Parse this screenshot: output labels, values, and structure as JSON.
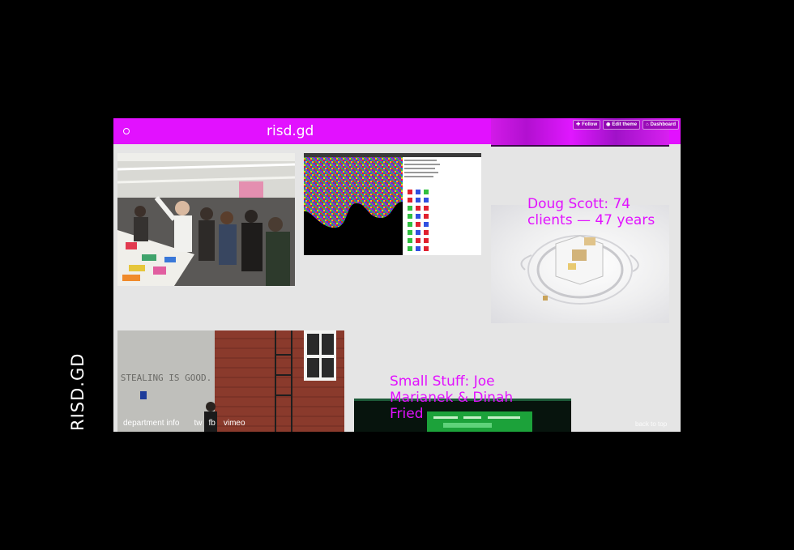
{
  "vertical_brand": "RISD.GD",
  "header": {
    "title": "risd.gd"
  },
  "tumblr_controls": {
    "follow": "Follow",
    "edit_theme": "Edit theme",
    "dashboard": "Dashboard"
  },
  "posts": {
    "doug_scott_title": "Doug Scott: 74 clients — 47 years",
    "small_stuff_title": "Small Stuff: Joe Marianek & Dinah Fried"
  },
  "mural_text": "STEALING IS GOOD.",
  "footer": {
    "links": [
      "department info",
      "tw",
      "fb",
      "vimeo"
    ],
    "back_to_top": "back to top"
  },
  "colors": {
    "accent": "#e211ff",
    "page_background": "#000000",
    "content_background": "#e5e5e5"
  }
}
